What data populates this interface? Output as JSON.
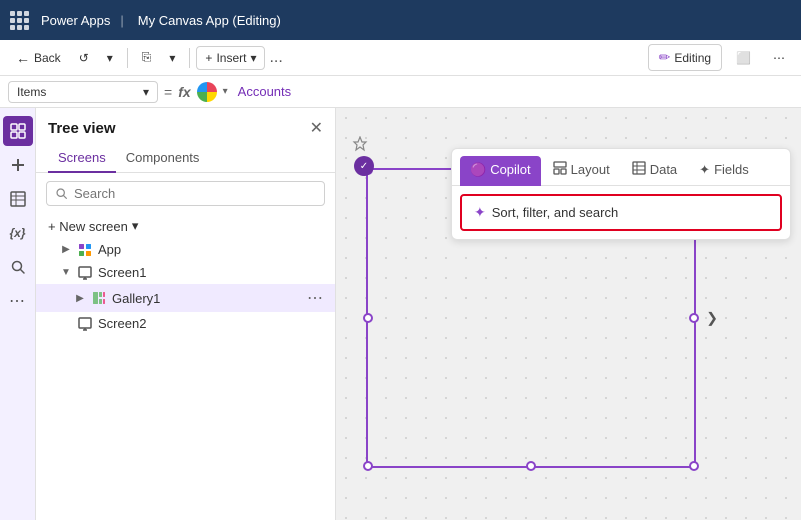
{
  "topbar": {
    "app_name": "Power Apps",
    "separator": "|",
    "canvas_title": "My Canvas App (Editing)"
  },
  "toolbar": {
    "back_label": "Back",
    "undo_label": "↺",
    "redo_label": "↻",
    "copy_label": "⎘",
    "insert_label": "Insert",
    "more_label": "...",
    "editing_label": "Editing"
  },
  "formula_bar": {
    "items_label": "Items",
    "equals": "=",
    "fx": "fx",
    "formula_value": "Accounts"
  },
  "tree_view": {
    "title": "Tree view",
    "close_icon": "✕",
    "tabs": [
      "Screens",
      "Components"
    ],
    "active_tab": 0,
    "search_placeholder": "Search",
    "new_screen_label": "+ New screen",
    "items": [
      {
        "id": "app",
        "label": "App",
        "level": 1,
        "has_caret": true,
        "expanded": false
      },
      {
        "id": "screen1",
        "label": "Screen1",
        "level": 1,
        "has_caret": true,
        "expanded": true
      },
      {
        "id": "gallery1",
        "label": "Gallery1",
        "level": 2,
        "has_caret": true,
        "expanded": false,
        "selected": true
      },
      {
        "id": "screen2",
        "label": "Screen2",
        "level": 1,
        "has_caret": false,
        "expanded": false
      }
    ]
  },
  "property_panel": {
    "tabs": [
      {
        "label": "Copilot",
        "icon": "🟣",
        "active": true
      },
      {
        "label": "Layout",
        "icon": "⊞",
        "active": false
      },
      {
        "label": "Data",
        "icon": "⊞",
        "active": false
      },
      {
        "label": "Fields",
        "icon": "✦",
        "active": false
      }
    ],
    "action": {
      "icon": "✦",
      "label": "Sort, filter, and search"
    }
  },
  "rail": {
    "icons": [
      "⊞",
      "+",
      "⊡",
      "{x}",
      "🔍",
      "⋯"
    ]
  }
}
